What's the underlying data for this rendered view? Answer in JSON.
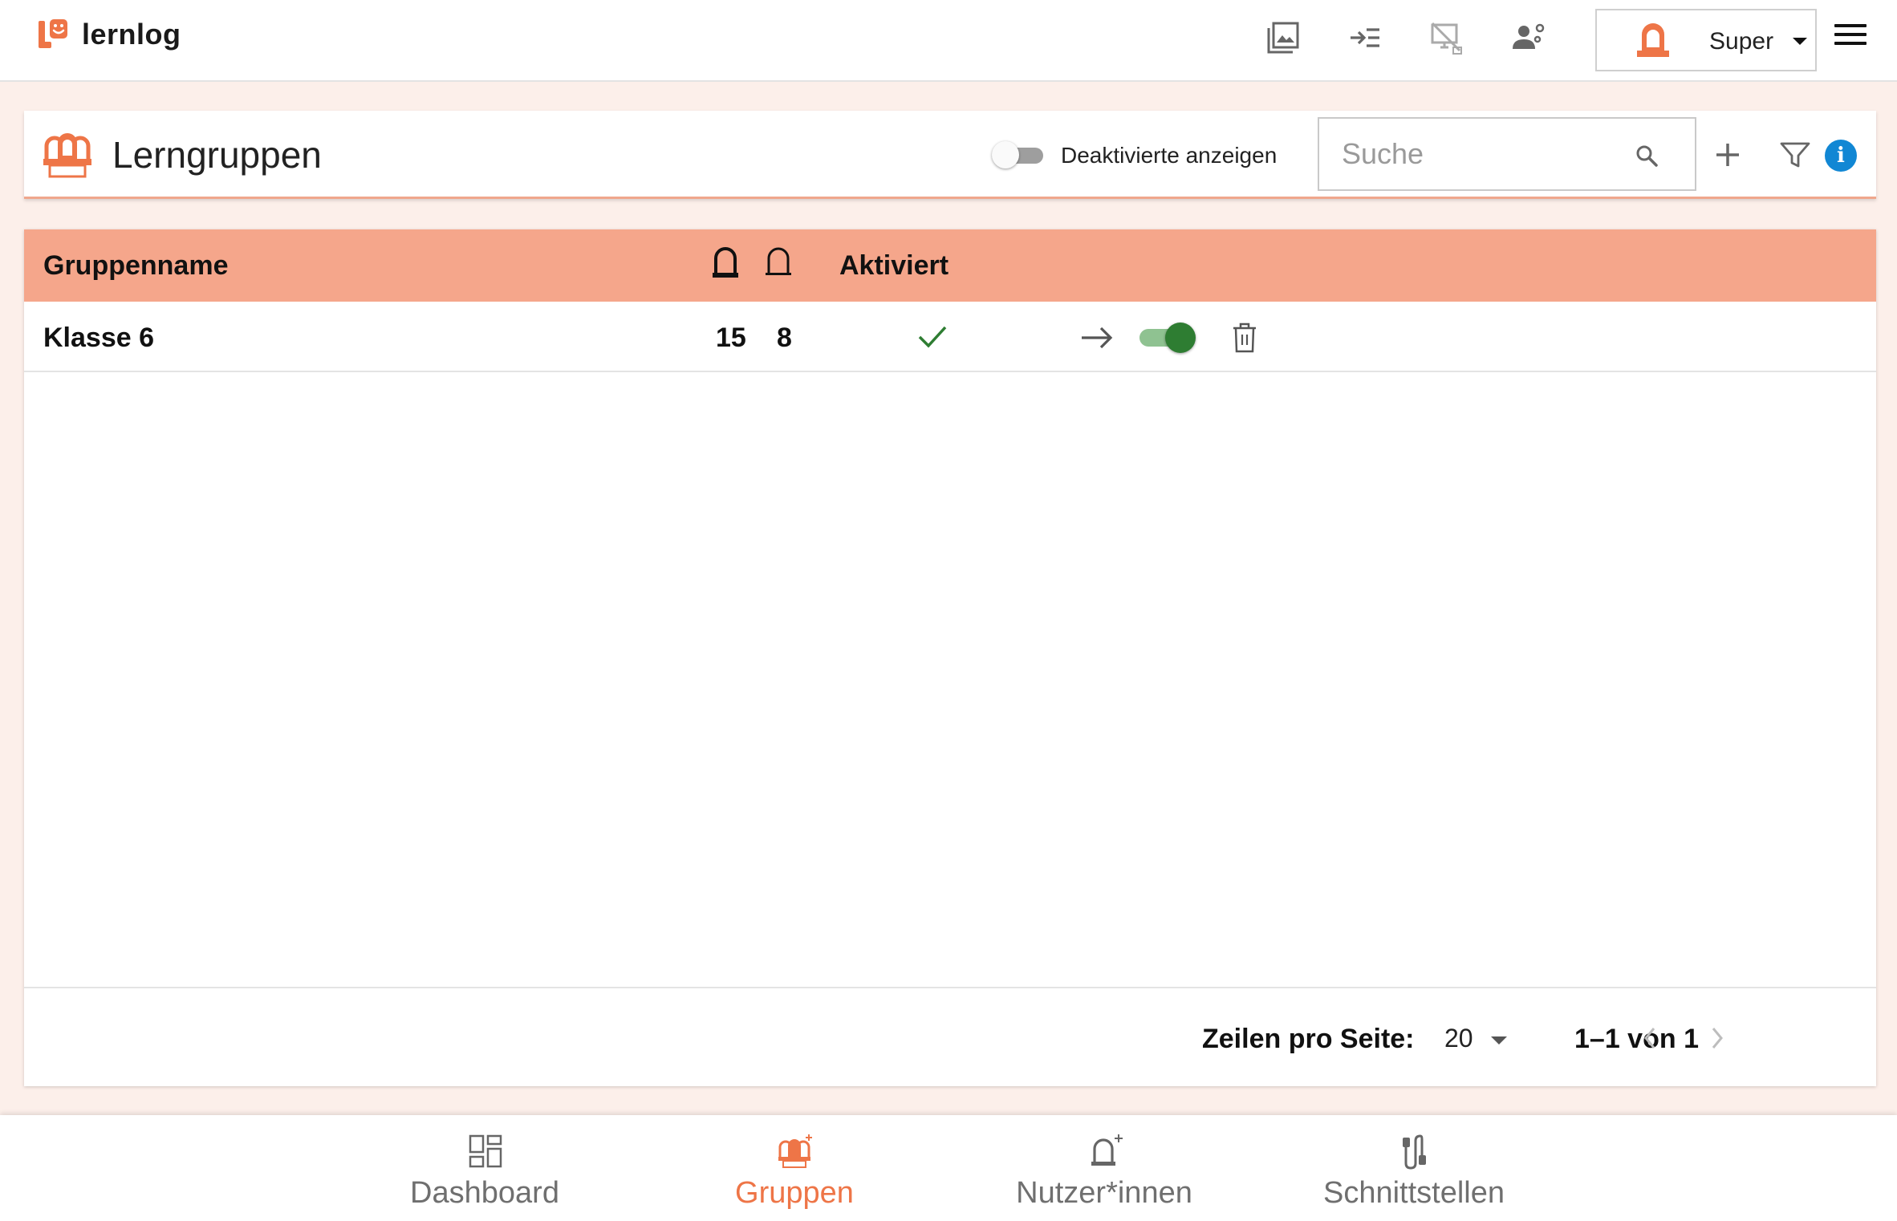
{
  "brand": {
    "name": "lernlog",
    "accent": "#ee7547"
  },
  "topbar": {
    "icons": [
      "gallery-icon",
      "tab-indent-icon",
      "screen-cleanup-icon",
      "user-settings-icon"
    ],
    "user": {
      "name": "Super"
    }
  },
  "header": {
    "title": "Lerngruppen",
    "toggle_label": "Deaktivierte anzeigen",
    "toggle_on": false,
    "search_placeholder": "Suche",
    "info_glyph": "i"
  },
  "table": {
    "columns": {
      "name": "Gruppenname",
      "activated": "Aktiviert"
    },
    "rows": [
      {
        "name": "Klasse 6",
        "count_a": "15",
        "count_b": "8",
        "activated": true,
        "toggle_on": true
      }
    ]
  },
  "footer": {
    "rows_per_page_label": "Zeilen pro Seite:",
    "rows_per_page": "20",
    "range": "1–1 von 1"
  },
  "bottom_nav": {
    "items": [
      {
        "label": "Dashboard",
        "icon": "dashboard-icon",
        "active": false
      },
      {
        "label": "Gruppen",
        "icon": "groups-icon",
        "active": true
      },
      {
        "label": "Nutzer*innen",
        "icon": "user-add-icon",
        "active": false
      },
      {
        "label": "Schnittstellen",
        "icon": "interfaces-icon",
        "active": false
      }
    ]
  },
  "colors": {
    "header_row": "#f5a68b",
    "page_bg": "#fcefea",
    "toggle_active": "#2e7d32",
    "info": "#1187d4"
  }
}
